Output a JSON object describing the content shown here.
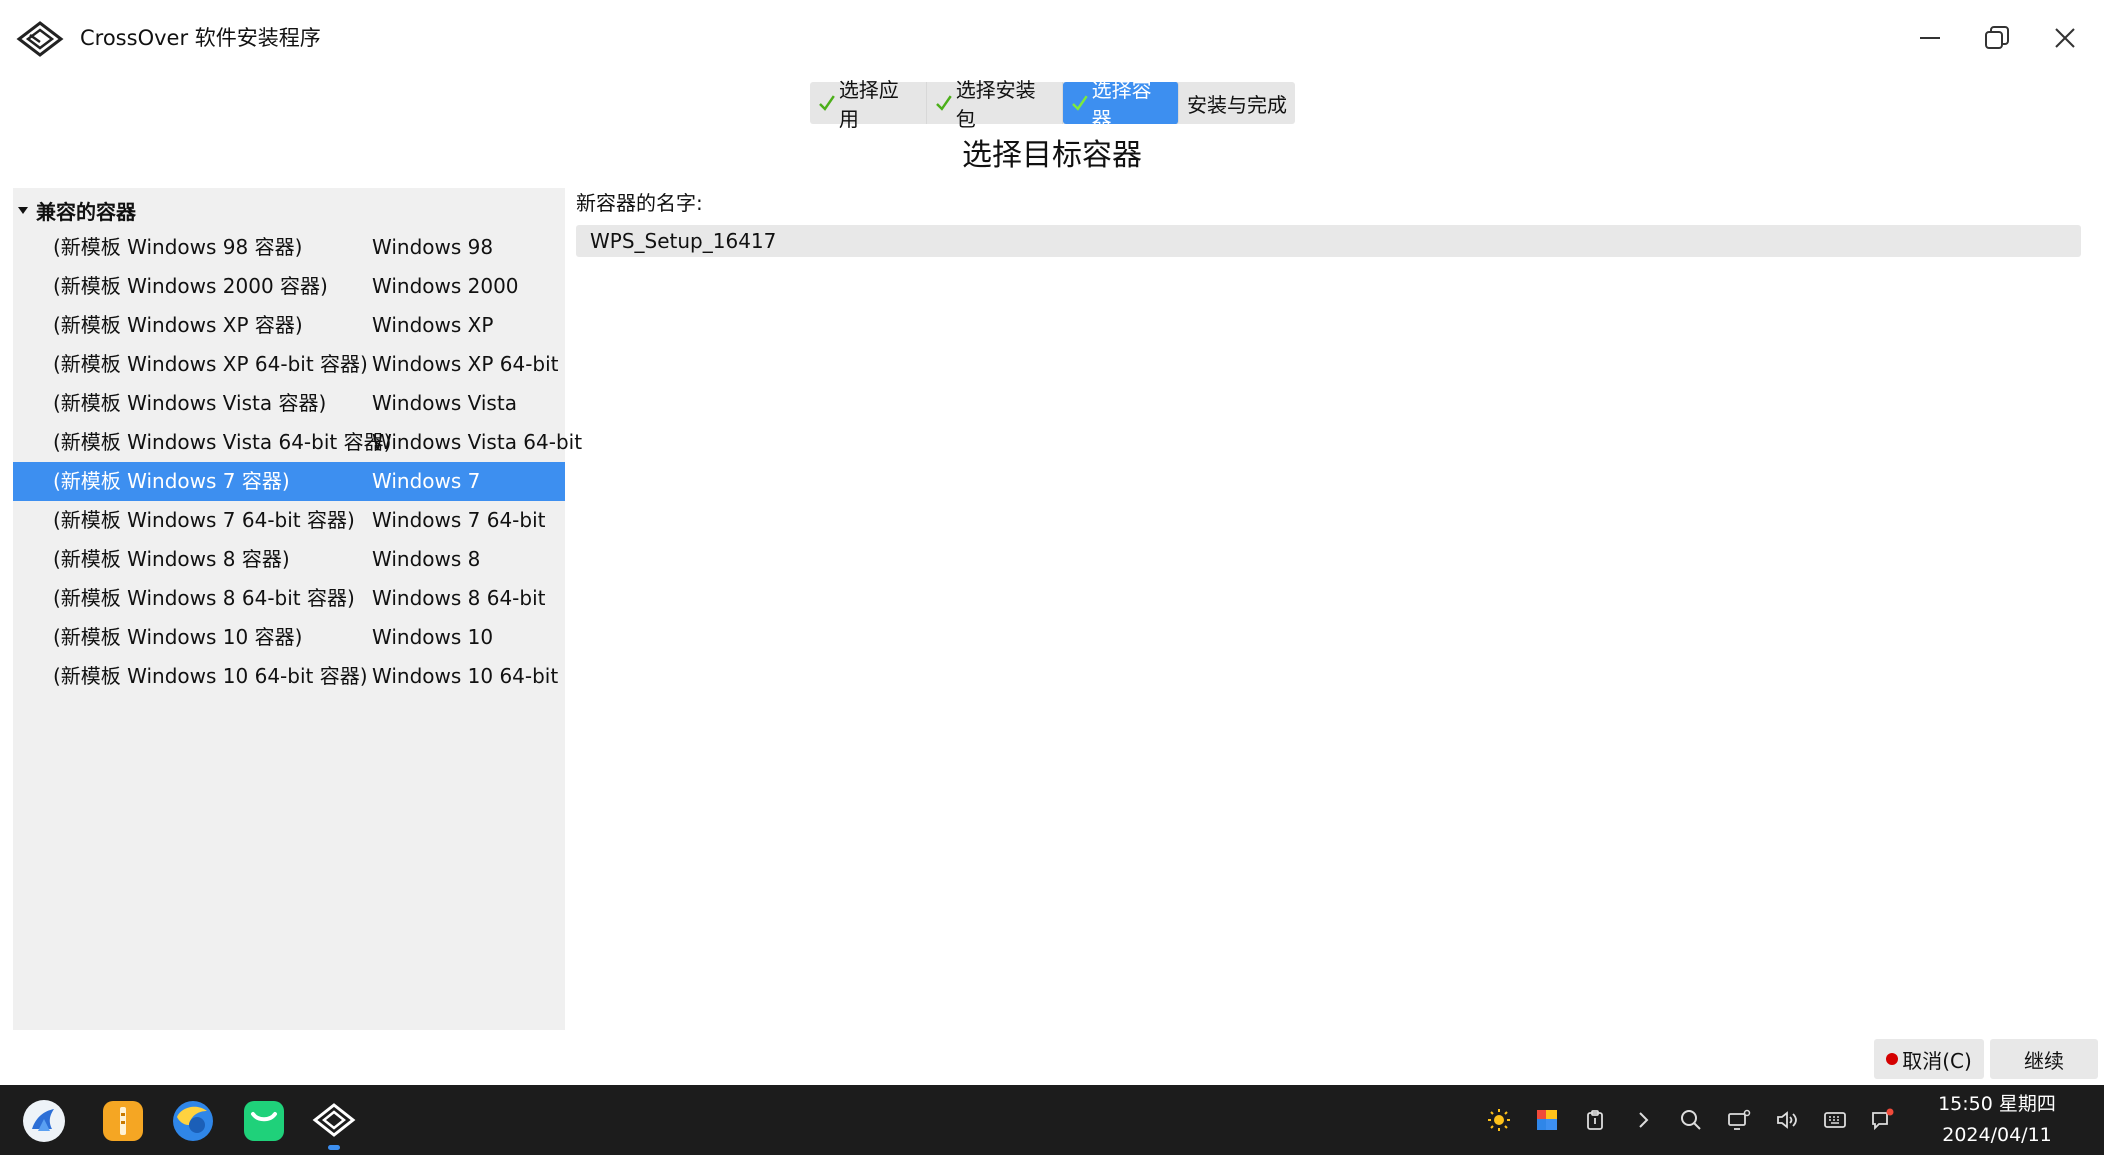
{
  "window": {
    "title": "CrossOver 软件安装程序"
  },
  "steps": [
    {
      "label": "选择应用",
      "done": true
    },
    {
      "label": "选择安装包",
      "done": true
    },
    {
      "label": "选择容器",
      "done": true,
      "active": true
    },
    {
      "label": "安装与完成",
      "done": false
    }
  ],
  "page_title": "选择目标容器",
  "tree": {
    "group_label": "兼容的容器",
    "rows": [
      {
        "name": "(新模板 Windows 98 容器)",
        "os": "Windows 98"
      },
      {
        "name": "(新模板 Windows 2000 容器)",
        "os": "Windows 2000"
      },
      {
        "name": "(新模板 Windows XP 容器)",
        "os": "Windows XP"
      },
      {
        "name": "(新模板 Windows XP 64-bit 容器)",
        "os": "Windows XP 64-bit"
      },
      {
        "name": "(新模板 Windows Vista 容器)",
        "os": "Windows Vista"
      },
      {
        "name": "(新模板 Windows Vista 64-bit 容器)",
        "os": "Windows Vista 64-bit"
      },
      {
        "name": "(新模板 Windows 7 容器)",
        "os": "Windows 7",
        "selected": true
      },
      {
        "name": "(新模板 Windows 7 64-bit 容器)",
        "os": "Windows 7 64-bit"
      },
      {
        "name": "(新模板 Windows 8 容器)",
        "os": "Windows 8"
      },
      {
        "name": "(新模板 Windows 8 64-bit 容器)",
        "os": "Windows 8 64-bit"
      },
      {
        "name": "(新模板 Windows 10 容器)",
        "os": "Windows 10"
      },
      {
        "name": "(新模板 Windows 10 64-bit 容器)",
        "os": "Windows 10 64-bit"
      }
    ]
  },
  "form": {
    "name_label": "新容器的名字:",
    "name_value": "WPS_Setup_16417"
  },
  "buttons": {
    "cancel": "取消(C)",
    "continue": "继续"
  },
  "taskbar": {
    "apps": [
      "launcher-icon",
      "file-manager-icon",
      "browser-icon",
      "chat-icon",
      "crossover-icon"
    ],
    "tray": [
      "brightness-icon",
      "color-picker-icon",
      "clipboard-icon",
      "chevron-right-icon",
      "search-icon",
      "display-icon",
      "volume-icon",
      "keyboard-icon",
      "notification-icon"
    ],
    "time": "15:50 星期四",
    "date": "2024/04/11"
  },
  "colors": {
    "accent": "#3d8ff0",
    "check": "#4caf1a",
    "taskbar_bg": "#1c1c1c"
  }
}
